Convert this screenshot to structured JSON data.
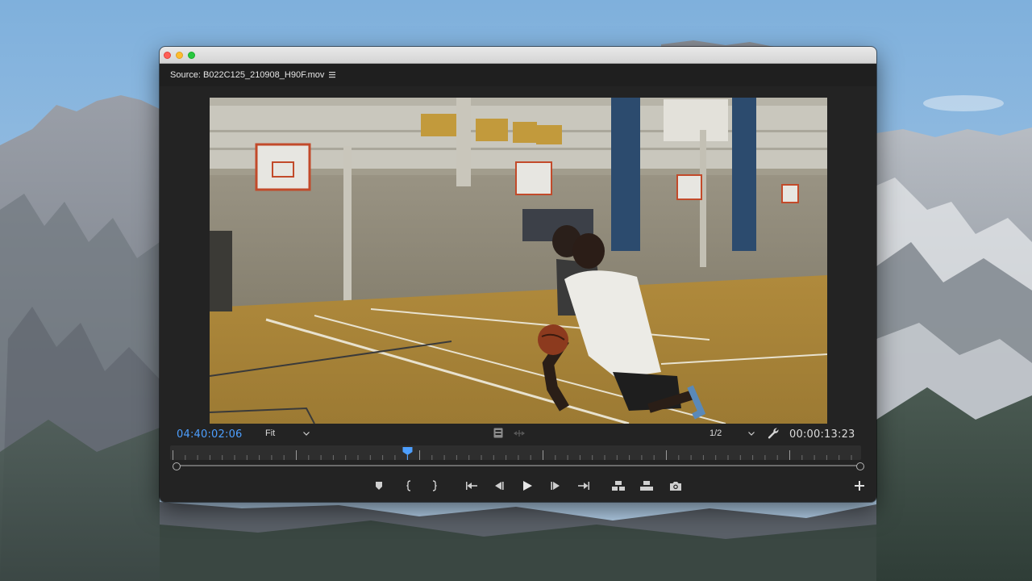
{
  "window": {
    "panel_title": "Source: B022C125_210908_H90F.mov",
    "traffic_lights": {
      "close": "#ff5f57",
      "minimize": "#febc2e",
      "zoom": "#28c840"
    }
  },
  "monitor": {
    "current_timecode": "04:40:02:06",
    "duration_timecode": "00:00:13:23",
    "zoom_level": "Fit",
    "playback_resolution": "1/2",
    "timecode_color": "#4d9fff"
  },
  "transport": [
    {
      "name": "add-marker-button",
      "icon": "marker-icon"
    },
    {
      "name": "mark-in-button",
      "icon": "mark-in-icon"
    },
    {
      "name": "mark-out-button",
      "icon": "mark-out-icon"
    },
    {
      "name": "go-to-in-button",
      "icon": "go-to-in-icon"
    },
    {
      "name": "step-back-button",
      "icon": "step-back-icon"
    },
    {
      "name": "play-button",
      "icon": "play-icon"
    },
    {
      "name": "step-forward-button",
      "icon": "step-forward-icon"
    },
    {
      "name": "go-to-out-button",
      "icon": "go-to-out-icon"
    },
    {
      "name": "insert-button",
      "icon": "insert-icon"
    },
    {
      "name": "overwrite-button",
      "icon": "overwrite-icon"
    },
    {
      "name": "export-frame-button",
      "icon": "camera-icon"
    },
    {
      "name": "button-editor-button",
      "icon": "plus-icon"
    }
  ]
}
